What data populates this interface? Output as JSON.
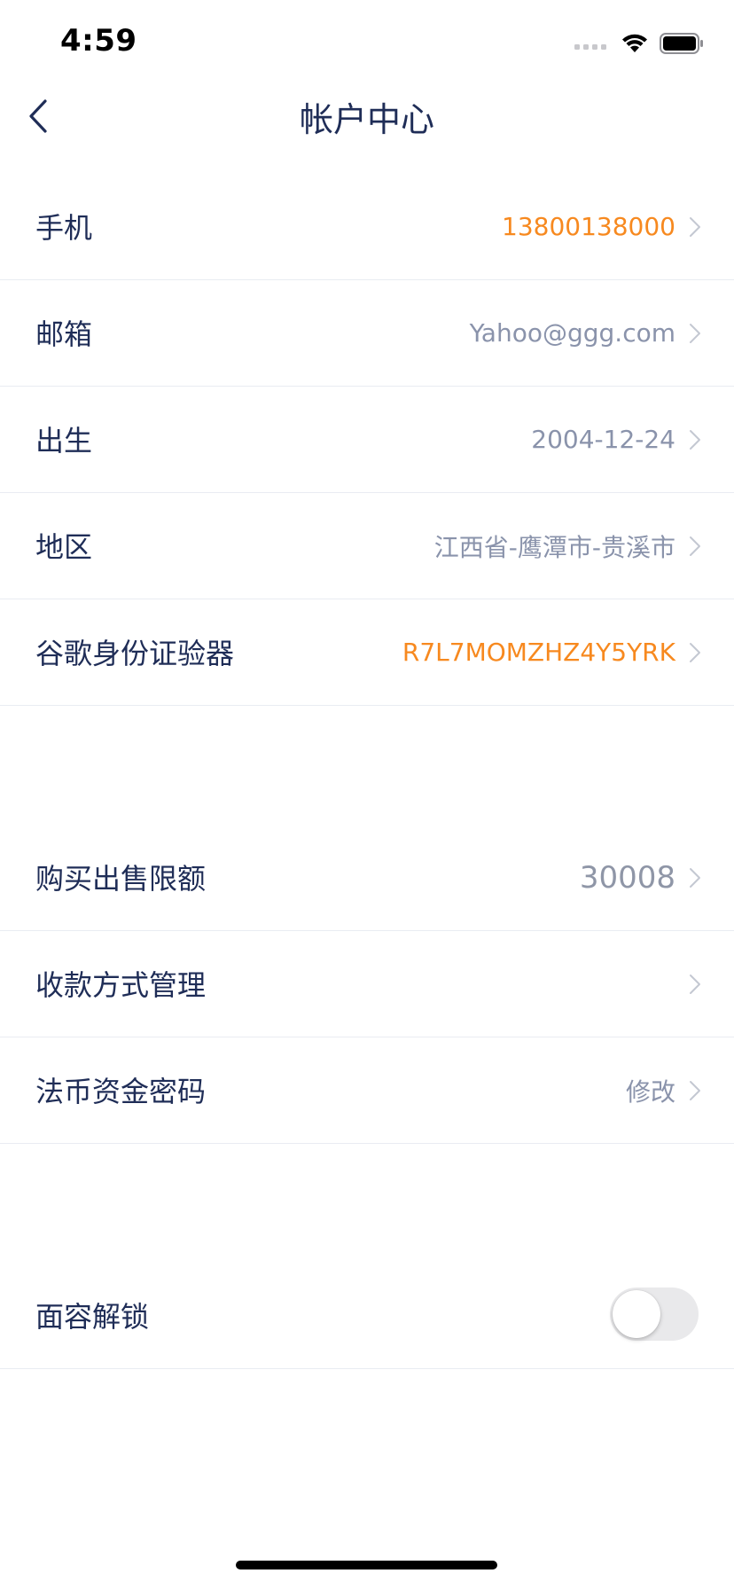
{
  "status_bar": {
    "time": "4:59"
  },
  "nav": {
    "title": "帐户中心"
  },
  "account_info": {
    "rows": [
      {
        "label": "手机",
        "value": "13800138000",
        "accent": "orange"
      },
      {
        "label": "邮箱",
        "value": "Yahoo@ggg.com",
        "accent": "gray"
      },
      {
        "label": "出生",
        "value": "2004-12-24",
        "accent": "gray"
      },
      {
        "label": "地区",
        "value": "江西省-鹰潭市-贵溪市",
        "accent": "gray"
      },
      {
        "label": "谷歌身份证验器",
        "value": "R7L7MOMZHZ4Y5YRK",
        "accent": "orange"
      }
    ]
  },
  "trade_settings": {
    "rows": [
      {
        "label": "购买出售限额",
        "value": "30008"
      },
      {
        "label": "收款方式管理",
        "value": ""
      },
      {
        "label": "法币资金密码",
        "value": "修改"
      }
    ]
  },
  "security": {
    "face_unlock_label": "面容解锁",
    "face_unlock_enabled": false
  },
  "colors": {
    "primary_text": "#1f2d57",
    "secondary_text": "#8a93ab",
    "accent_orange": "#f7891f",
    "divider": "#e9ecf2",
    "toggle_off": "#e9e9eb"
  }
}
